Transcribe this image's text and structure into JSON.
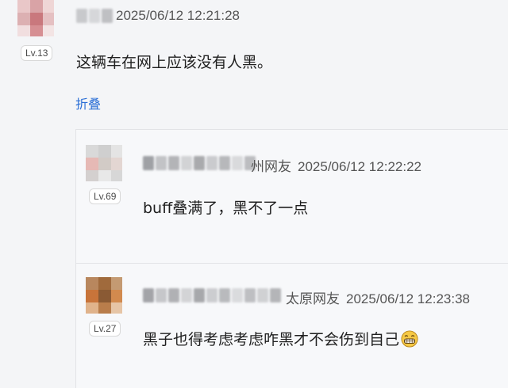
{
  "main_comment": {
    "level": "Lv.13",
    "timestamp": "2025/06/12 12:21:28",
    "text": "这辆车在网上应该没有人黑。",
    "fold_label": "折叠"
  },
  "replies": [
    {
      "level": "Lv.69",
      "location": "州网友",
      "timestamp": "2025/06/12 12:22:22",
      "text": "buff叠满了，黑不了一点"
    },
    {
      "level": "Lv.27",
      "location": "太原网友",
      "timestamp": "2025/06/12 12:23:38",
      "text": "黑子也得考虑考虑咋黑才不会伤到自己",
      "emoji": "grinning-face-icon"
    }
  ]
}
